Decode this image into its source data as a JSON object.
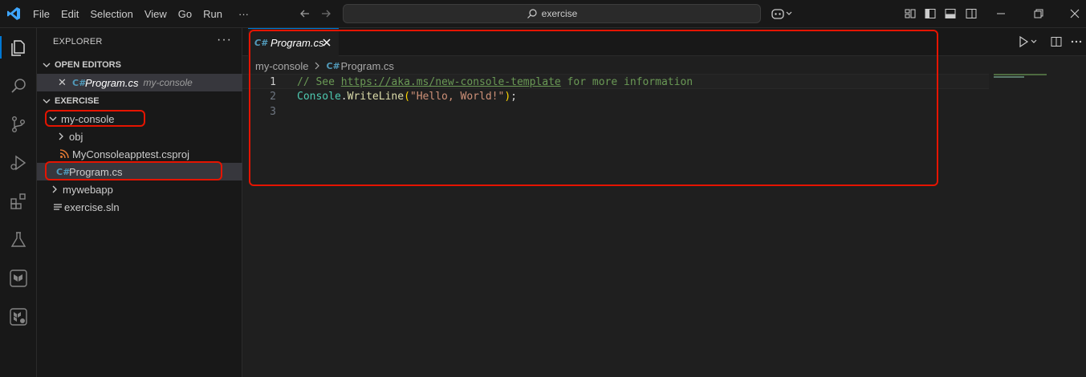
{
  "titlebar": {
    "menu": [
      "File",
      "Edit",
      "Selection",
      "View",
      "Go",
      "Run",
      "···"
    ],
    "search_text": "exercise"
  },
  "sidebar": {
    "title": "EXPLORER",
    "more": "···",
    "open_editors": {
      "heading": "OPEN EDITORS",
      "items": [
        {
          "close": "✕",
          "file": "Program.cs",
          "folder": "my-console"
        }
      ]
    },
    "workspace": {
      "heading": "EXERCISE",
      "tree": [
        {
          "label": "my-console"
        },
        {
          "label": "obj"
        },
        {
          "label": "MyConsoleapptest.csproj"
        },
        {
          "label": "Program.cs"
        },
        {
          "label": "mywebapp"
        },
        {
          "label": "exercise.sln"
        }
      ]
    }
  },
  "editor": {
    "tab": {
      "label": "Program.cs",
      "icon_text": "C#"
    },
    "breadcrumb": [
      "my-console",
      "Program.cs"
    ],
    "lines": [
      {
        "number": "1",
        "comment_prefix": "// See ",
        "link": "https://aka.ms/new-console-template",
        "comment_suffix": " for more information"
      },
      {
        "number": "2",
        "class": "Console",
        "dot": ".",
        "method": "WriteLine",
        "open_paren": "(",
        "string": "\"Hello, World!\"",
        "close_paren": ")",
        "semi": ";"
      },
      {
        "number": "3"
      }
    ]
  },
  "colors": {
    "accent": "#0078d4",
    "annotation_red": "#e51400",
    "csharp_icon": "#519aba"
  }
}
